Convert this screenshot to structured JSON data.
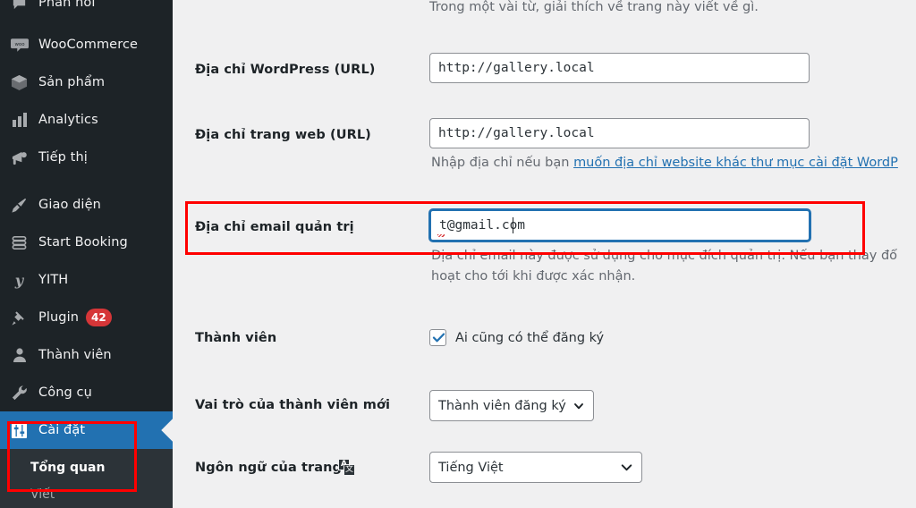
{
  "sidebar": {
    "items": [
      {
        "label": "Phản hồi",
        "icon": "comments-icon",
        "current": false,
        "badge": null
      },
      {
        "label": "WooCommerce",
        "icon": "woocommerce-icon",
        "current": false,
        "badge": null
      },
      {
        "label": "Sản phẩm",
        "icon": "products-box-icon",
        "current": false,
        "badge": null
      },
      {
        "label": "Analytics",
        "icon": "bar-chart-icon",
        "current": false,
        "badge": null
      },
      {
        "label": "Tiếp thị",
        "icon": "megaphone-icon",
        "current": false,
        "badge": null
      },
      {
        "label": "Giao diện",
        "icon": "paintbrush-icon",
        "current": false,
        "badge": null
      },
      {
        "label": "Start Booking",
        "icon": "booking-icon",
        "current": false,
        "badge": null
      },
      {
        "label": "YITH",
        "icon": "yith-icon",
        "current": false,
        "badge": null
      },
      {
        "label": "Plugin",
        "icon": "plug-icon",
        "current": false,
        "badge": "42"
      },
      {
        "label": "Thành viên",
        "icon": "user-icon",
        "current": false,
        "badge": null
      },
      {
        "label": "Công cụ",
        "icon": "wrench-icon",
        "current": false,
        "badge": null
      },
      {
        "label": "Cài đặt",
        "icon": "settings-sliders-icon",
        "current": true,
        "badge": null
      }
    ],
    "submenu": [
      {
        "label": "Tổng quan",
        "current": true
      },
      {
        "label": "Viết",
        "current": false
      }
    ],
    "colors": {
      "background": "#1d2327",
      "submenu_background": "#2c3338",
      "current_highlight": "#2271b1",
      "badge": "#d63638"
    }
  },
  "main": {
    "tagline_help": "Trong một vài từ, giải thích về trang này viết về gì.",
    "fields": {
      "wordpress_address": {
        "label": "Địa chỉ WordPress (URL)",
        "value": "http://gallery.local"
      },
      "site_address": {
        "label": "Địa chỉ trang web (URL)",
        "value": "http://gallery.local",
        "help_prefix": "Nhập địa chỉ nếu bạn ",
        "help_link": "muốn địa chỉ website khác thư mục cài đặt WordP"
      },
      "admin_email": {
        "label": "Địa chỉ email quản trị",
        "value": "t@gmail.com",
        "help_line1": "Địa chỉ email này được sử dụng cho mục đích quản trị. Nếu bạn thay đổ",
        "help_line2": "hoạt cho tới khi được xác nhận."
      },
      "membership": {
        "label": "Thành viên",
        "checkbox_label": "Ai cũng có thể đăng ký",
        "checked": true
      },
      "default_role": {
        "label": "Vai trò của thành viên mới",
        "value": "Thành viên đăng ký"
      },
      "site_language": {
        "label": "Ngôn ngữ của trang",
        "icon": "translate-icon",
        "value": "Tiếng Việt"
      }
    }
  },
  "annotations": {
    "color": "#ff0000",
    "boxes": [
      {
        "name": "admin-email-highlight"
      },
      {
        "name": "settings-menu-highlight"
      }
    ]
  }
}
